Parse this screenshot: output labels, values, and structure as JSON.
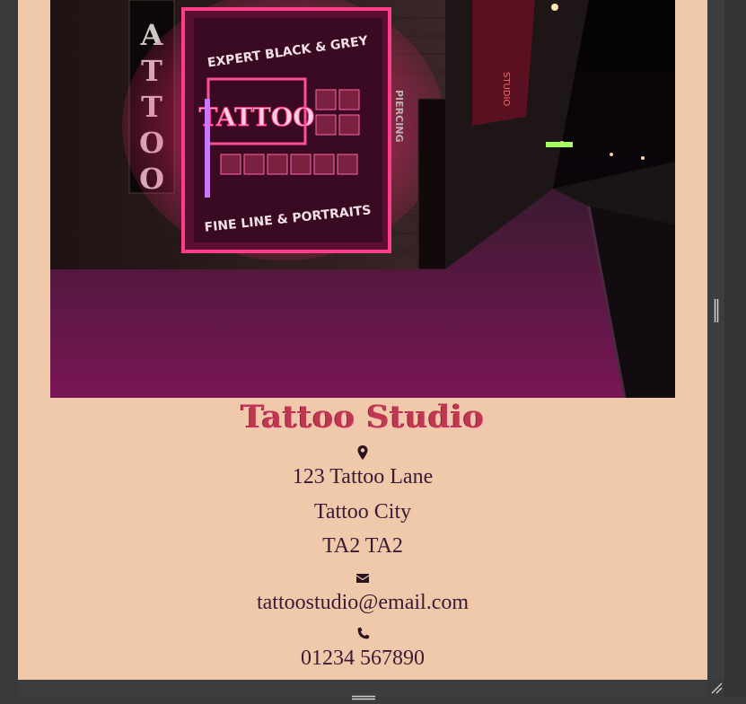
{
  "studio": {
    "name": "Tattoo Studio",
    "address": {
      "line1": "123 Tattoo Lane",
      "line2": "Tattoo City",
      "postcode": "TA2 TA2"
    },
    "email": "tattoostudio@email.com",
    "phone": "01234 567890"
  },
  "hero_image": {
    "description_icon": "neon-storefront-photo",
    "neon_sign_text": "TATTOO",
    "window_sign_top": "EXPERT BLACK & GREY",
    "window_sign_bottom": "FINE LINE & PORTRAITS",
    "vertical_sign": "TATTOO",
    "side_sign": "PIERCING"
  },
  "icons": {
    "location": "map-marker-icon",
    "email": "envelope-icon",
    "phone": "phone-icon"
  },
  "colors": {
    "page_background": "#f0c8aa",
    "title": "#c0384f",
    "text": "#3a1b35",
    "chrome": "#3a3a3a"
  }
}
